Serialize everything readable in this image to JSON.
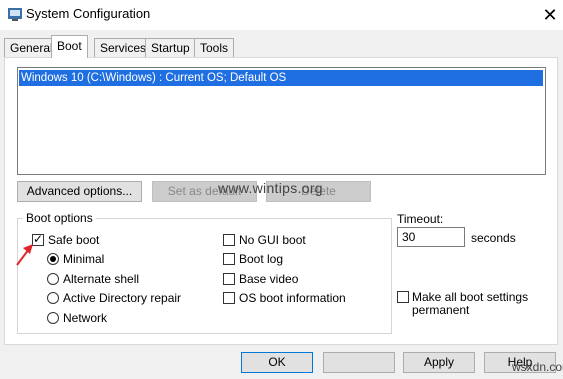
{
  "window": {
    "title": "System Configuration",
    "close_glyph": "✕"
  },
  "tabs": [
    {
      "label": "General",
      "active": false
    },
    {
      "label": "Boot",
      "active": true
    },
    {
      "label": "Services",
      "active": false
    },
    {
      "label": "Startup",
      "active": false
    },
    {
      "label": "Tools",
      "active": false
    }
  ],
  "os_list": {
    "items": [
      "Windows 10 (C:\\Windows) : Current OS; Default OS"
    ],
    "selected": 0
  },
  "buttons": {
    "advanced": "Advanced options...",
    "set_default": "Set as default",
    "delete": "Delete",
    "ok": "OK",
    "apply": "Apply",
    "help": "Help"
  },
  "boot_options": {
    "group_label": "Boot options",
    "safe_boot": {
      "label": "Safe boot",
      "checked": true
    },
    "radios": [
      {
        "label": "Minimal",
        "checked": true
      },
      {
        "label": "Alternate shell",
        "checked": false
      },
      {
        "label": "Active Directory repair",
        "checked": false
      },
      {
        "label": "Network",
        "checked": false
      }
    ],
    "checks": [
      {
        "label": "No GUI boot",
        "checked": false
      },
      {
        "label": "Boot log",
        "checked": false
      },
      {
        "label": "Base video",
        "checked": false
      },
      {
        "label": "OS boot information",
        "checked": false
      }
    ]
  },
  "timeout": {
    "label": "Timeout:",
    "value": "30",
    "unit": "seconds"
  },
  "permanent": {
    "label_line1": "Make all boot settings",
    "label_line2": "permanent",
    "checked": false
  },
  "watermark": {
    "text": "www.wintips.org",
    "corner": "wsxdn.com"
  },
  "colors": {
    "selection": "#1f6fe3",
    "accent": "#0078d7",
    "arrow": "#e0262b"
  },
  "icons": {
    "app": "system-configuration-icon",
    "close": "close-icon",
    "arrow": "red-arrow-annotation"
  }
}
